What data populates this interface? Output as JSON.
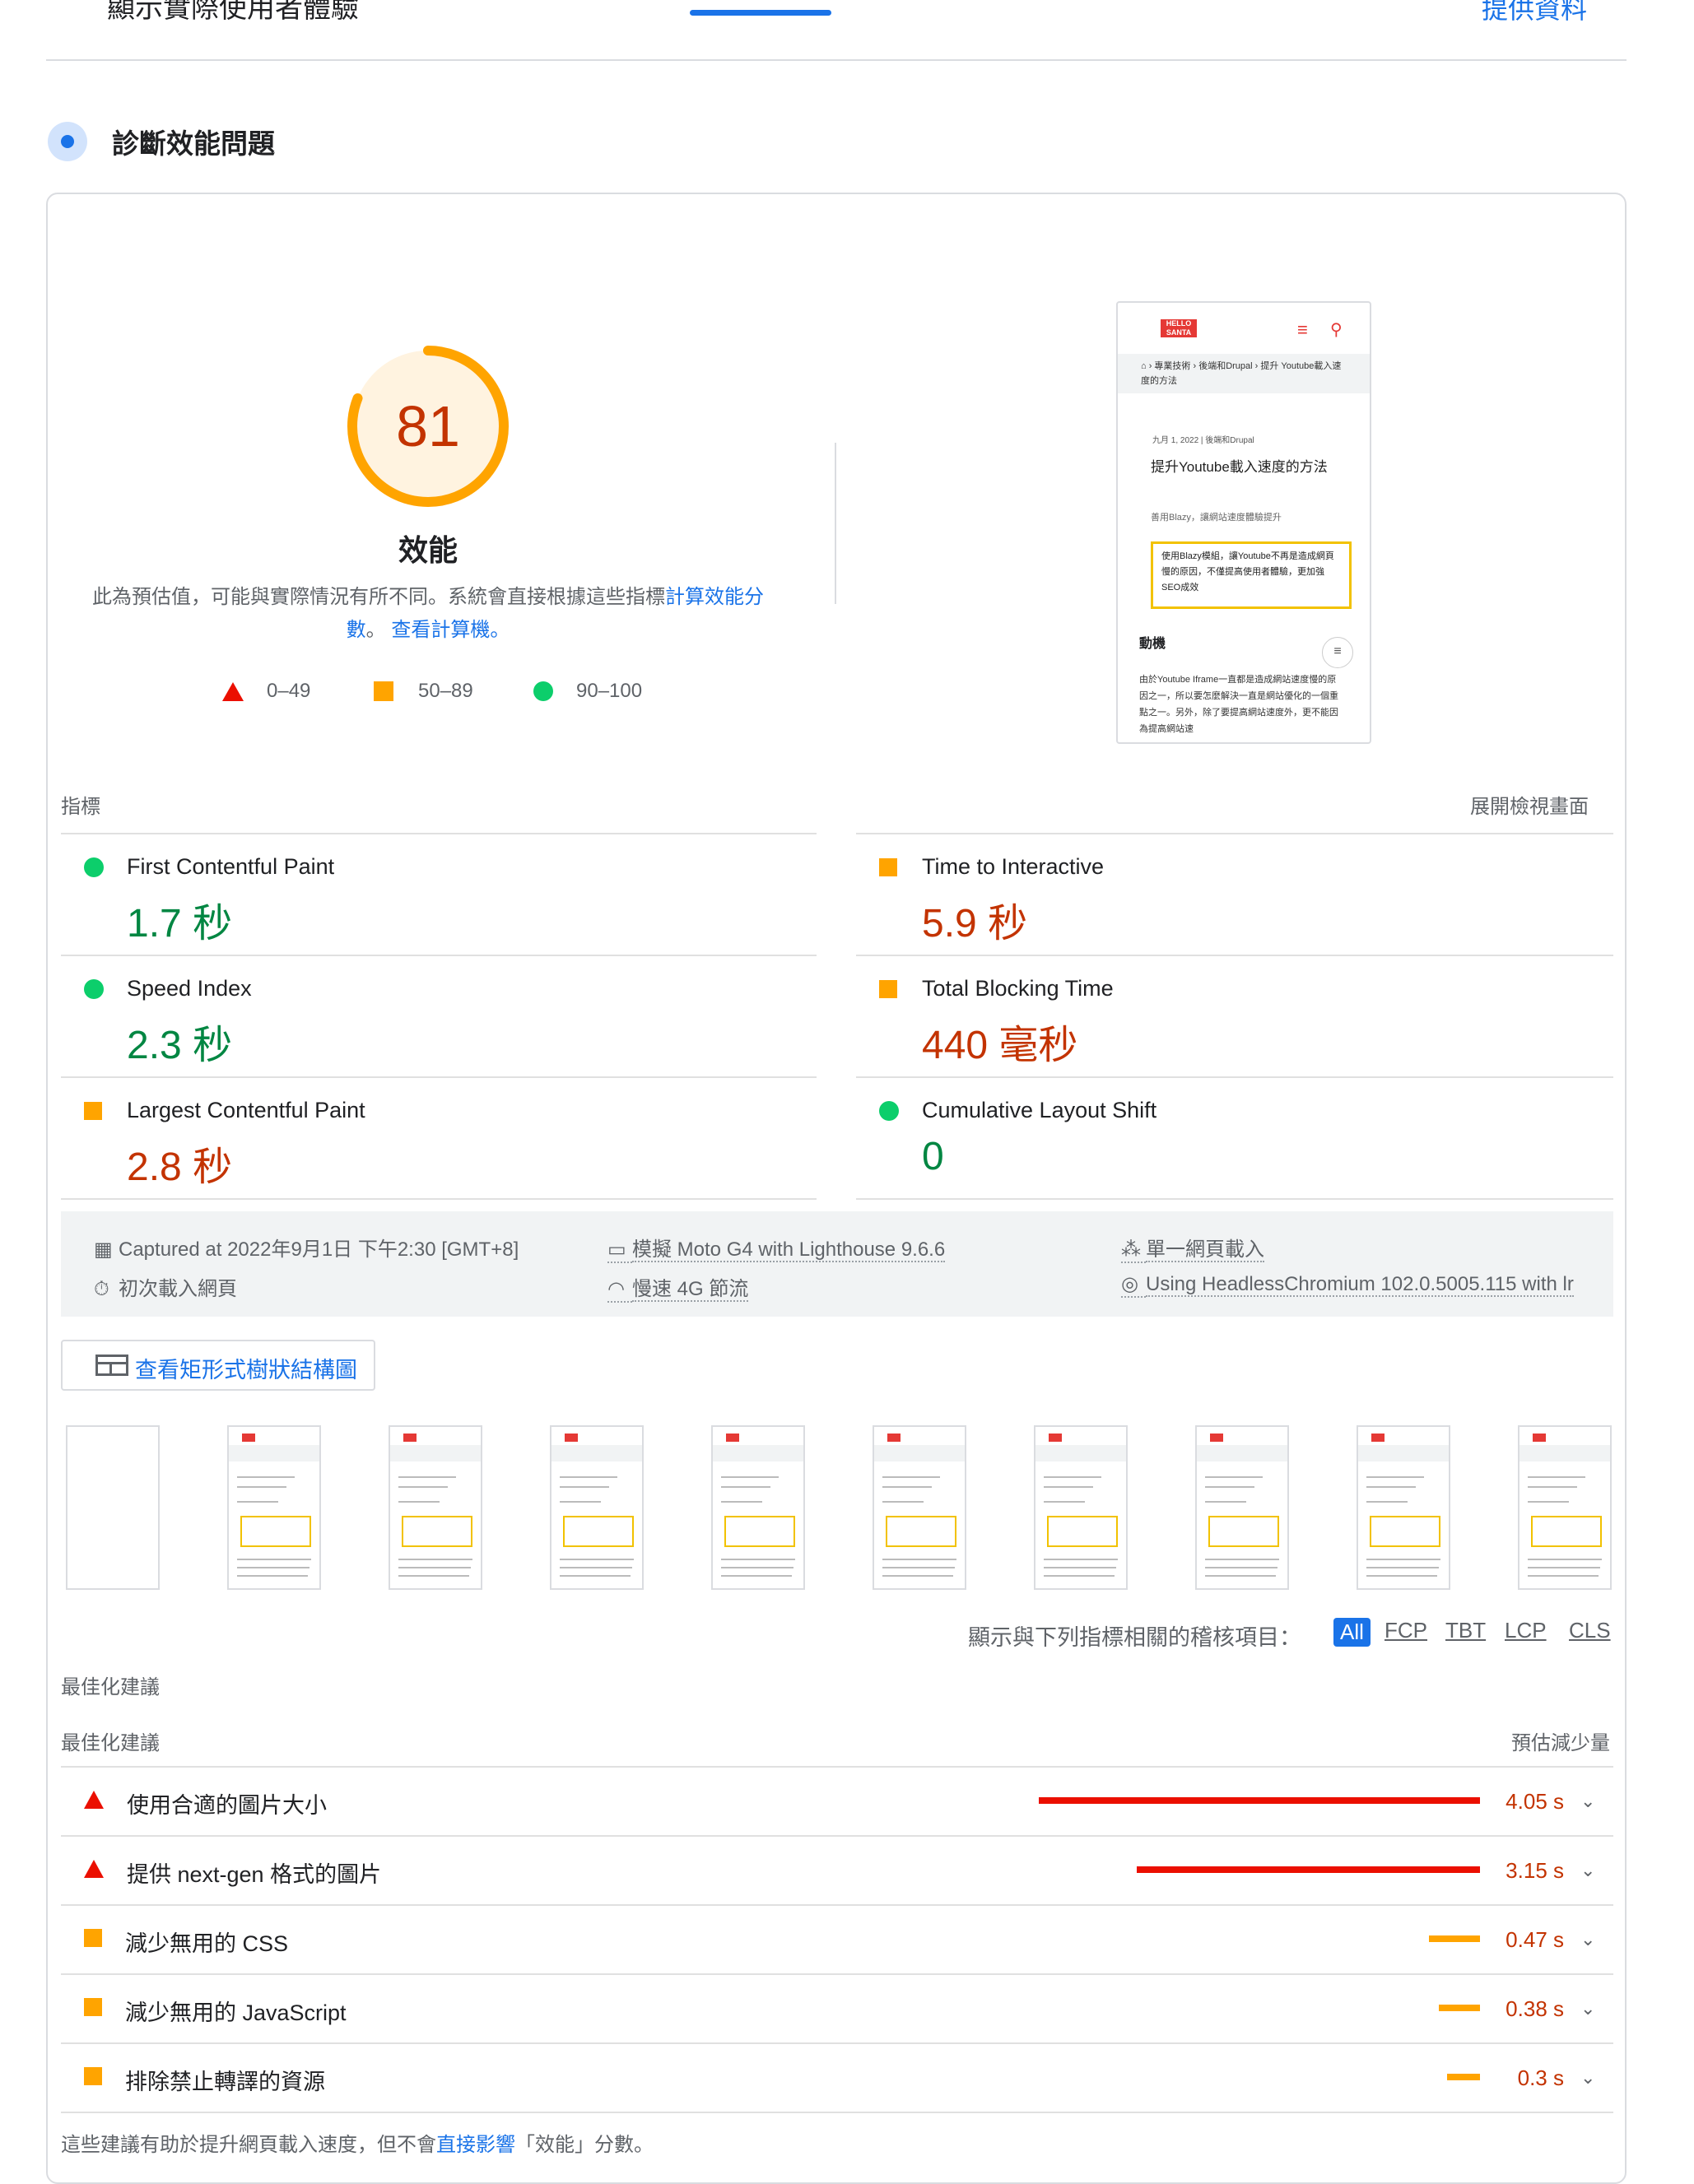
{
  "top": {
    "fragment": "顯示實際使用者體驗",
    "link": "提供資料"
  },
  "diagnose": {
    "title": "診斷效能問題"
  },
  "score": {
    "value": "81",
    "label": "效能",
    "fraction": 0.81,
    "color": "#ffa400"
  },
  "description": {
    "pre": "此為預估值，可能與實際情況有所不同。系統會直接根據這些指標",
    "link1": "計算效能分數",
    "mid": "。",
    "link2": "查看計算機。"
  },
  "legend": [
    {
      "icon": "fail-triangle",
      "range": "0–49"
    },
    {
      "icon": "average-square",
      "range": "50–89"
    },
    {
      "icon": "pass-circle",
      "range": "90–100"
    }
  ],
  "preview": {
    "logo": "HELLO SANTA",
    "breadcrumb": "⌂ › 專業技術 › 後端和Drupal › 提升 Youtube載入速度的方法",
    "date": "九月 1, 2022 | 後端和Drupal",
    "heading": "提升Youtube載入速度的方法",
    "subtitle": "善用Blazy，讓網站速度體驗提升",
    "callout": "使用Blazy模組，讓Youtube不再是造成網頁慢的原因，不僅提高使用者體驗，更加強SEO成效",
    "section": "動機",
    "body": "由於Youtube Iframe一直都是造成網站速度慢的原因之一，所以要怎麼解決一直是網站優化的一個重點之一。另外，除了要提高網站速度外，更不能因為提高網站速"
  },
  "metrics": {
    "label": "指標",
    "expand": "展開檢視畫面",
    "items": [
      {
        "name": "First Contentful Paint",
        "value": "1.7 秒",
        "status": "pass"
      },
      {
        "name": "Time to Interactive",
        "value": "5.9 秒",
        "status": "average"
      },
      {
        "name": "Speed Index",
        "value": "2.3 秒",
        "status": "pass"
      },
      {
        "name": "Total Blocking Time",
        "value": "440 毫秒",
        "status": "average"
      },
      {
        "name": "Largest Contentful Paint",
        "value": "2.8 秒",
        "status": "average"
      },
      {
        "name": "Cumulative Layout Shift",
        "value": "0",
        "status": "pass"
      }
    ]
  },
  "environment": {
    "captured": "Captured at 2022年9月1日 下午2:30 [GMT+8]",
    "load": "初次載入網頁",
    "device": "模擬 Moto G4 with Lighthouse 9.6.6",
    "network": "慢速 4G 節流",
    "session": "單一網頁載入",
    "browser": "Using HeadlessChromium 102.0.5005.115 with lr"
  },
  "treemap": {
    "label": "查看矩形式樹狀結構圖"
  },
  "filter": {
    "label": "顯示與下列指標相關的稽核項目：",
    "options": [
      "All",
      "FCP",
      "TBT",
      "LCP",
      "CLS"
    ],
    "selected": "All"
  },
  "opportunities": {
    "section_label": "最佳化建議",
    "header_label": "最佳化建議",
    "savings_label": "預估減少量",
    "items": [
      {
        "name": "使用合適的圖片大小",
        "value": "4.05 s",
        "status": "fail",
        "seconds": 4.05
      },
      {
        "name": "提供 next-gen 格式的圖片",
        "value": "3.15 s",
        "status": "fail",
        "seconds": 3.15
      },
      {
        "name": "減少無用的 CSS",
        "value": "0.47 s",
        "status": "average",
        "seconds": 0.47
      },
      {
        "name": "減少無用的 JavaScript",
        "value": "0.38 s",
        "status": "average",
        "seconds": 0.38
      },
      {
        "name": "排除禁止轉譯的資源",
        "value": "0.3 s",
        "status": "average",
        "seconds": 0.3
      }
    ]
  },
  "footnote": {
    "pre": "這些建議有助於提升網頁載入速度，但不會",
    "link": "直接影響",
    "post": "「效能」分數。"
  },
  "colors": {
    "fail": "#eb0f00",
    "average": "#ffa400",
    "pass": "#0cce6b",
    "link": "#1a73e8"
  }
}
